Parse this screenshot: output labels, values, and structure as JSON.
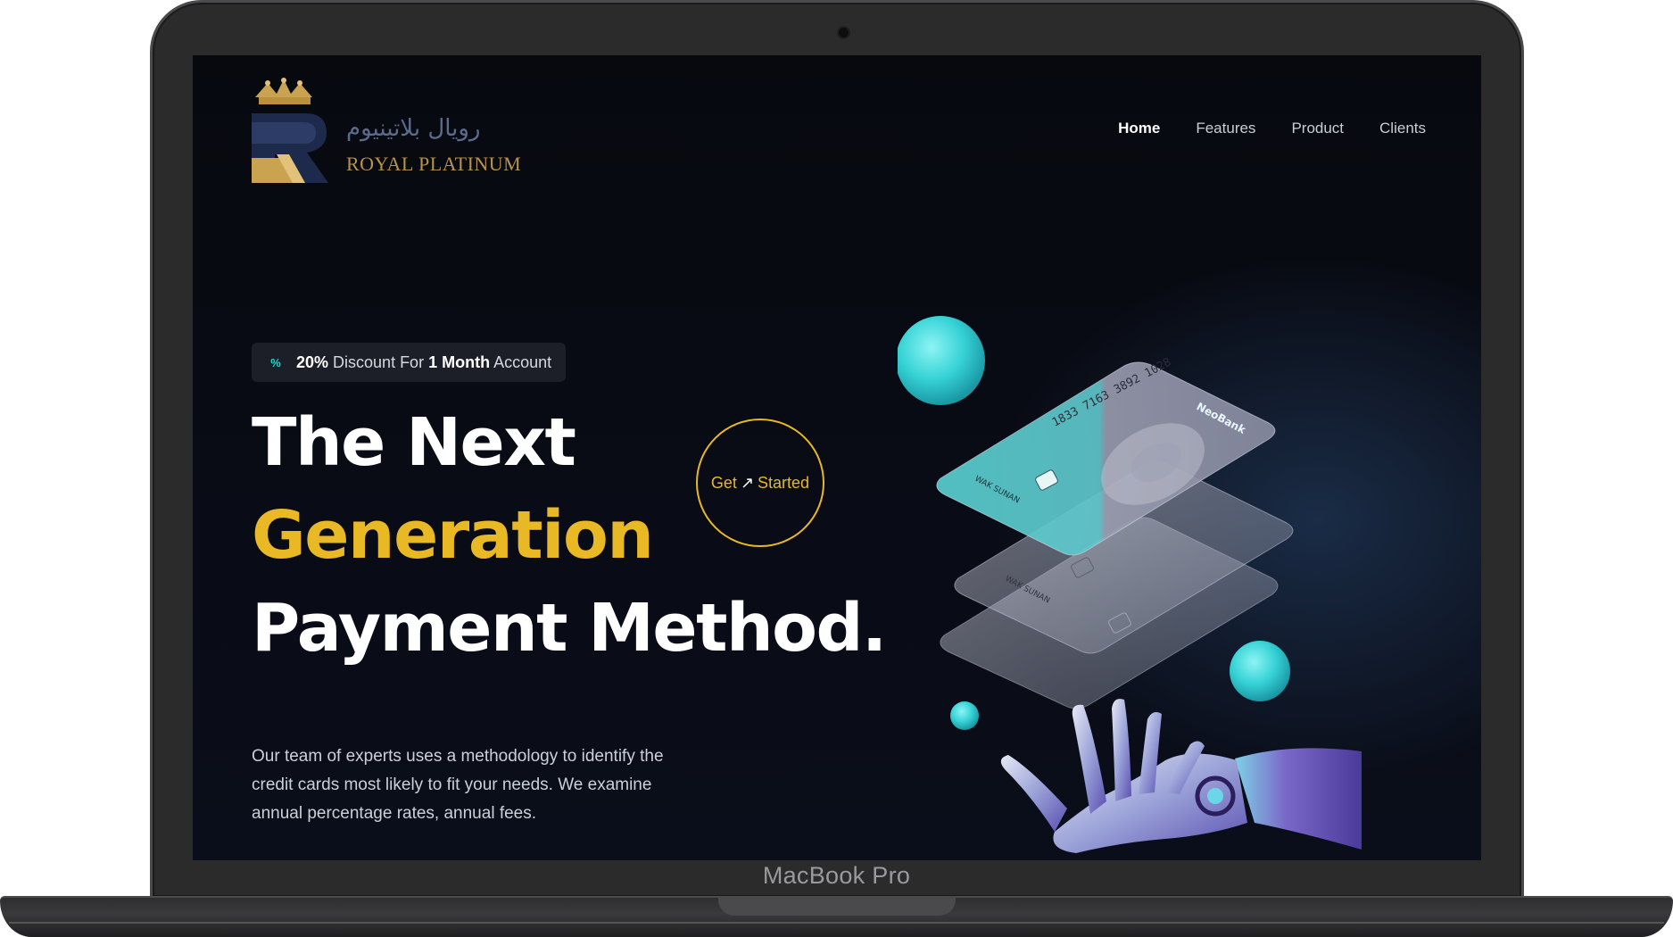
{
  "device": {
    "model_label": "MacBook Pro"
  },
  "brand": {
    "arabic_name": "رويال بلاتينيوم",
    "name": "ROYAL PLATINUM",
    "logo_letter": "R"
  },
  "nav": {
    "items": [
      {
        "label": "Home",
        "active": true
      },
      {
        "label": "Features",
        "active": false
      },
      {
        "label": "Product",
        "active": false
      },
      {
        "label": "Clients",
        "active": false
      }
    ]
  },
  "hero": {
    "badge": {
      "icon": "percent-icon",
      "part1": "20%",
      "part2": " Discount For ",
      "part3": "1 Month",
      "part4": " Account"
    },
    "title_line1": "The Next",
    "title_line2": "Generation",
    "title_line3": "Payment Method.",
    "description": "Our team of experts uses a methodology to identify the credit cards most likely to fit your needs. We examine annual percentage rates, annual fees.",
    "cta": {
      "word1": "Get",
      "arrow": "↗",
      "word2": "Started"
    }
  },
  "illustration": {
    "card_number": "1833 7163 3892 1028",
    "card_brand": "NeoBank",
    "card_holder": "WAK SUNAN"
  },
  "colors": {
    "accent": "#e9b825",
    "teal": "#2ad1d1",
    "background": "#07090f"
  }
}
